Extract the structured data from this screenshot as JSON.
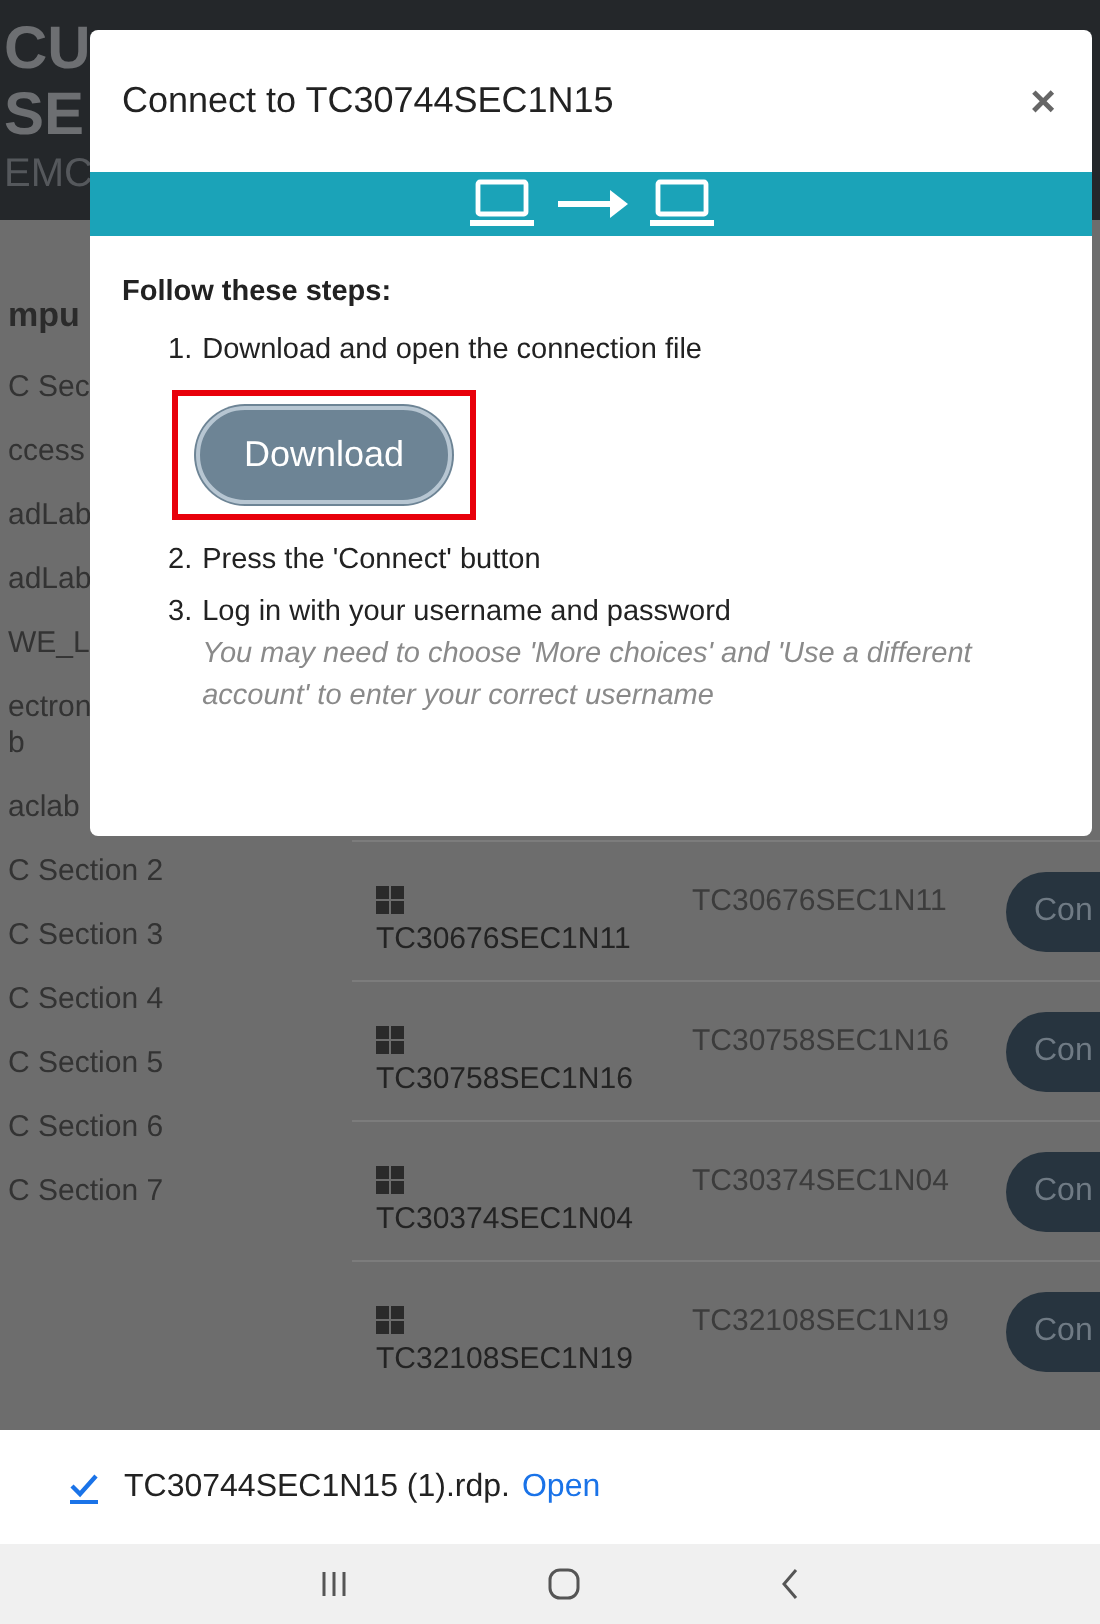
{
  "header": {
    "title_lines": [
      "CU",
      "SE",
      "EMC"
    ]
  },
  "sidebar": {
    "heading": "mpu",
    "items": [
      "C Sec",
      "ccess",
      "adLab",
      "adLab",
      "WE_L",
      "ectron\nb",
      "aclab",
      "C Section 2",
      "C Section 3",
      "C Section 4",
      "C Section 5",
      "C Section 6",
      "C Section 7"
    ]
  },
  "table": {
    "rows": [
      {
        "name": "TC30676SEC1N11",
        "column_2": "TC30676SEC1N11",
        "action": "Con"
      },
      {
        "name": "TC30758SEC1N16",
        "column_2": "TC30758SEC1N16",
        "action": "Con"
      },
      {
        "name": "TC30374SEC1N04",
        "column_2": "TC30374SEC1N04",
        "action": "Con"
      },
      {
        "name": "TC32108SEC1N19",
        "column_2": "TC32108SEC1N19",
        "action": "Con"
      }
    ]
  },
  "dialog": {
    "title": "Connect to TC30744SEC1N15",
    "close": "×",
    "heading": "Follow these steps:",
    "steps": [
      {
        "number": "1.",
        "text": "Download and open the connection file"
      },
      {
        "number": "2.",
        "text": "Press the 'Connect' button"
      },
      {
        "number": "3.",
        "text": "Log in with your username and password",
        "note": "You may need to choose 'More choices' and 'Use a different account' to enter your correct username"
      }
    ],
    "download_button": {
      "label": "Download",
      "highlighted": true
    }
  },
  "download_bar": {
    "file": "TC30744SEC1N15 (1).rdp.",
    "link": "Open"
  }
}
